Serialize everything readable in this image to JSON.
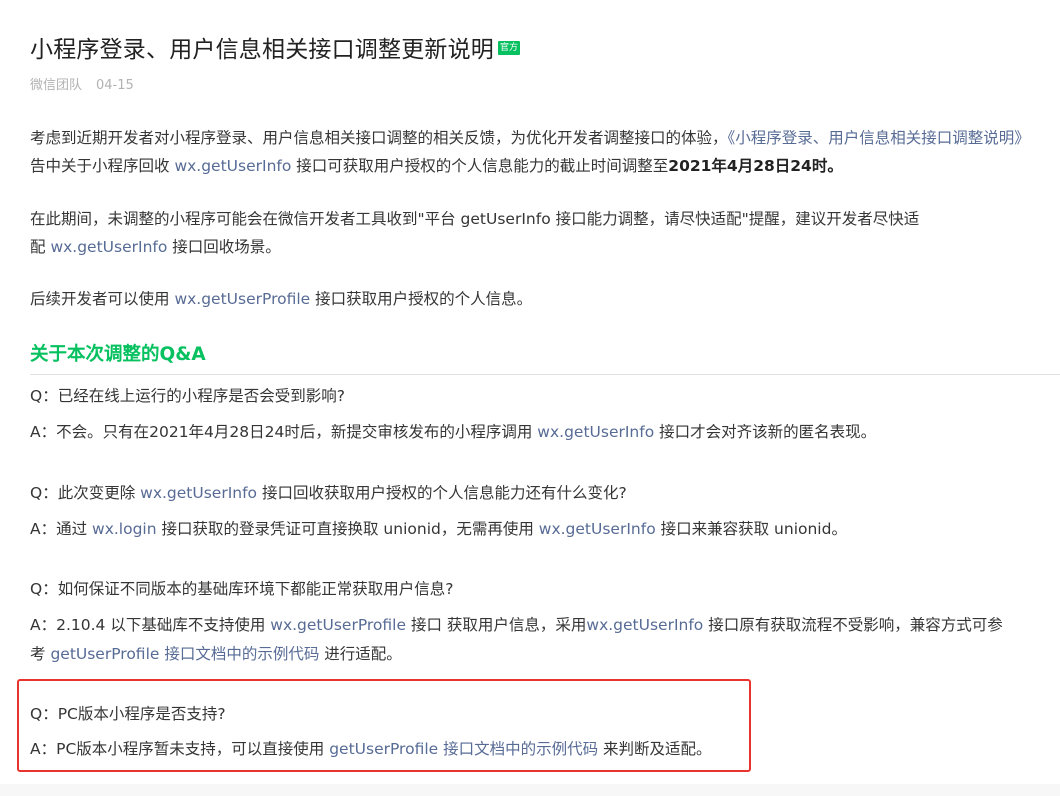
{
  "article": {
    "title": "小程序登录、用户信息相关接口调整更新说明",
    "badge": "官方",
    "author": "微信团队",
    "date": "04-15"
  },
  "intro": {
    "p1_line1_text": "考虑到近期开发者对小程序登录、用户信息相关接口调整的相关反馈，为优化开发者调整接口的体验，",
    "p1_line1_link": "《小程序登录、用户信息相关接口调整说明》",
    "p1_line2_a": "告中关于小程序回收 ",
    "p1_line2_link": "wx.getUserInfo",
    "p1_line2_b": " 接口可获取用户授权的个人信息能力的截止时间调整至",
    "p1_line2_bold": "2021年4月28日24时。",
    "p2_line1": "在此期间，未调整的小程序可能会在微信开发者工具收到\"平台 getUserInfo 接口能力调整，请尽快适配\"提醒，建议开发者尽快适",
    "p2_line2_a": "配 ",
    "p2_line2_link": "wx.getUserInfo",
    "p2_line2_b": " 接口回收场景。",
    "p3_a": "后续开发者可以使用 ",
    "p3_link": "wx.getUserProfile",
    "p3_b": " 接口获取用户授权的个人信息。"
  },
  "qa": {
    "heading": "关于本次调整的Q&A",
    "q1": "Q：已经在线上运行的小程序是否会受到影响?",
    "a1_a": "A：不会。只有在2021年4月28日24时后，新提交审核发布的小程序调用 ",
    "a1_link": "wx.getUserInfo",
    "a1_b": " 接口才会对齐该新的匿名表现。",
    "q2_a": "Q：此次变更除 ",
    "q2_link": "wx.getUserInfo",
    "q2_b": " 接口回收获取用户授权的个人信息能力还有什么变化?",
    "a2_a": "A：通过 ",
    "a2_link1": "wx.login",
    "a2_b": " 接口获取的登录凭证可直接换取 unionid，无需再使用 ",
    "a2_link2": "wx.getUserInfo",
    "a2_c": " 接口来兼容获取 unionid。",
    "q3": "Q：如何保证不同版本的基础库环境下都能正常获取用户信息?",
    "a3_a": "A：2.10.4 以下基础库不支持使用 ",
    "a3_link1": "wx.getUserProfile",
    "a3_b": " 接口 获取用户信息，采用",
    "a3_link2": "wx.getUserInfo",
    "a3_c": " 接口原有获取流程不受影响，兼容方式可参",
    "a3_line2_a": "考 ",
    "a3_line2_link": "getUserProfile 接口文档中的示例代码",
    "a3_line2_b": " 进行适配。",
    "q4": "Q：PC版本小程序是否支持?",
    "a4_a": "A：PC版本小程序暂未支持，可以直接使用 ",
    "a4_link": "getUserProfile 接口文档中的示例代码",
    "a4_b": " 来判断及适配。"
  },
  "colors": {
    "accent_green": "#07c160",
    "link_blue": "#576b95",
    "highlight_red": "#e8332f"
  }
}
